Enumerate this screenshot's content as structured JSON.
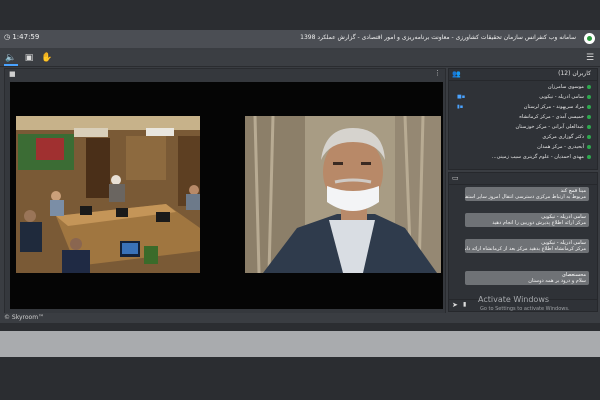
{
  "header": {
    "timer": "1:47:59",
    "title": "سامانه وب کنفرانس سازمان تحقیقات کشاورزی - معاونت برنامه‌ریزی و امور اقتصادی - گزارش عملکرد 1398"
  },
  "toolbar": {
    "buttons": [
      {
        "icon": "speaker-icon"
      },
      {
        "icon": "screen-share-icon"
      },
      {
        "icon": "raise-hand-icon"
      }
    ],
    "menu_icon": "hamburger-menu-icon"
  },
  "video": {
    "header_icon": "camera-icon",
    "feeds": [
      {
        "description_icon": "conference-room"
      },
      {
        "description_icon": "webcam-speaker"
      }
    ]
  },
  "users_panel": {
    "title": "کاربران (12)",
    "users": [
      "موسوی سامرزان",
      "سامی ادریله - نیکویی",
      "مراد سرپهوند - مرکز لرستان",
      "خمیسی آمدی - مرکز کرمانشاه",
      "عبدالعلی آبرانی - مرکز خوزستان",
      "دکتر گوزاری مرکزی",
      "آبحیدری - مرکز همدان",
      "مهدی احمدیان - علوم گزینری سیب زمینی..."
    ]
  },
  "chat_panel": {
    "messages": [
      {
        "name": "مینا قمچ کند",
        "text": "مربوط به ارتباط مرکزی دسترسی انتقال امروز سایر استفاده ها از"
      },
      {
        "name": "سامی ادریله - نیکویی",
        "text": "مرکز ارائه اطلاع پذیرش دوربین را انجام دهید"
      },
      {
        "name": "سامی ادریله - نیکویی",
        "text": "مرکز کرمانشاه اطلاع بدهید مرکز بعد از کرمانشاه ارائه داشته باشد"
      },
      {
        "name": "محسنعصای",
        "text": "سلام و درود بر همه دوستان"
      }
    ],
    "send_icon": "send-icon",
    "mic_icon": "microphone-icon"
  },
  "watermark": {
    "line1": "Activate Windows",
    "line2": "Go to Settings to activate Windows."
  },
  "footer": {
    "brand": "© Skyroom™"
  }
}
